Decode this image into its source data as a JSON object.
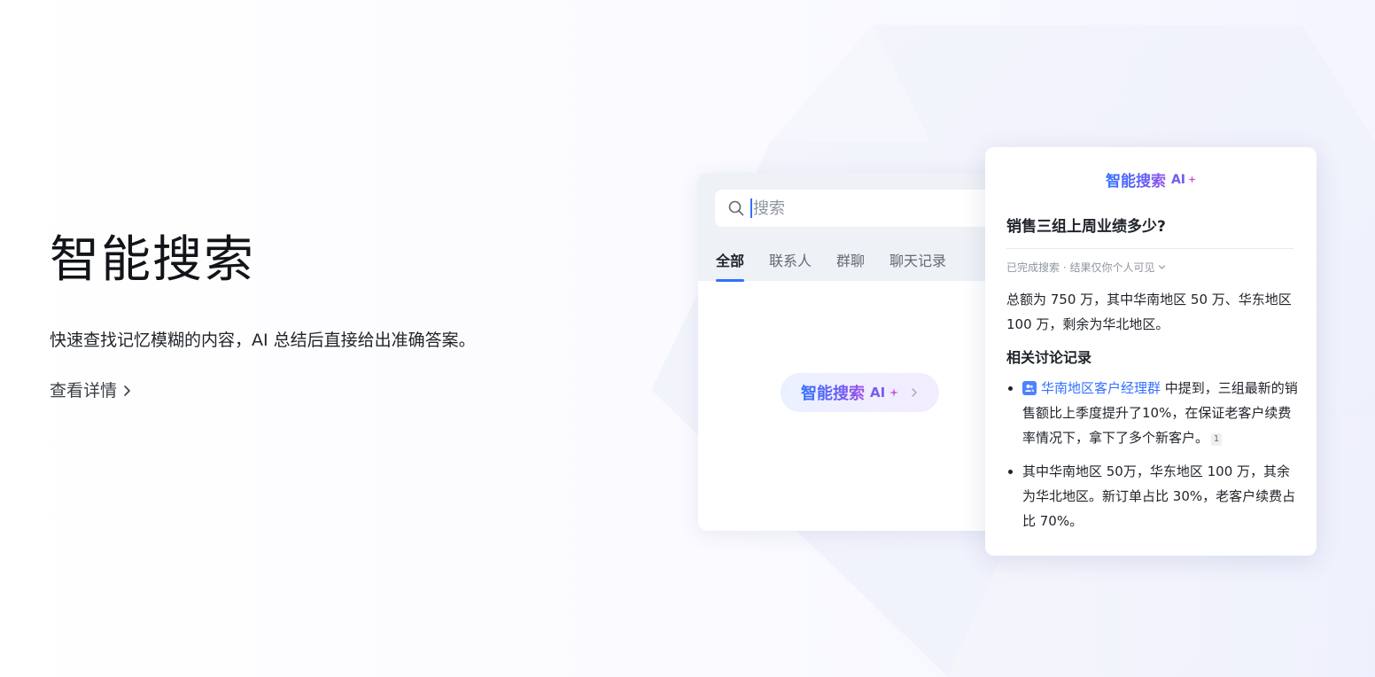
{
  "hero": {
    "title": "智能搜索",
    "description": "快速查找记忆模糊的内容，AI 总结后直接给出准确答案。",
    "link_label": "查看详情"
  },
  "search_panel": {
    "placeholder": "搜索",
    "tabs": [
      "全部",
      "联系人",
      "群聊",
      "聊天记录"
    ],
    "active_tab": "全部",
    "ai_button_label": "智能搜索",
    "ai_button_badge": "AI"
  },
  "answer_card": {
    "header_title": "智能搜索",
    "header_badge": "AI",
    "question": "销售三组上周业绩多少?",
    "status": "已完成搜索 · 结果仅你个人可见",
    "answer": "总额为 750 万，其中华南地区 50 万、华东地区 100 万，剩余为华北地区。",
    "related_title": "相关讨论记录",
    "bullets": [
      {
        "group_name": "华南地区客户经理群",
        "text": " 中提到，三组最新的销售额比上季度提升了10%，在保证老客户续费率情况下，拿下了多个新客户。",
        "citation": "1"
      },
      {
        "text": "其中华南地区 50万，华东地区 100 万，其余为华北地区。新订单占比 30%，老客户续费占比 70%。"
      }
    ]
  },
  "colors": {
    "accent": "#3370ff",
    "ai_purple": "#7b5cf0",
    "text_primary": "#1f2329",
    "text_secondary": "#8f959e"
  },
  "icons": {
    "search": "magnifier-icon",
    "chevron": "chevron-right-icon",
    "sparkle": "sparkle-icon",
    "group": "group-chat-icon"
  }
}
